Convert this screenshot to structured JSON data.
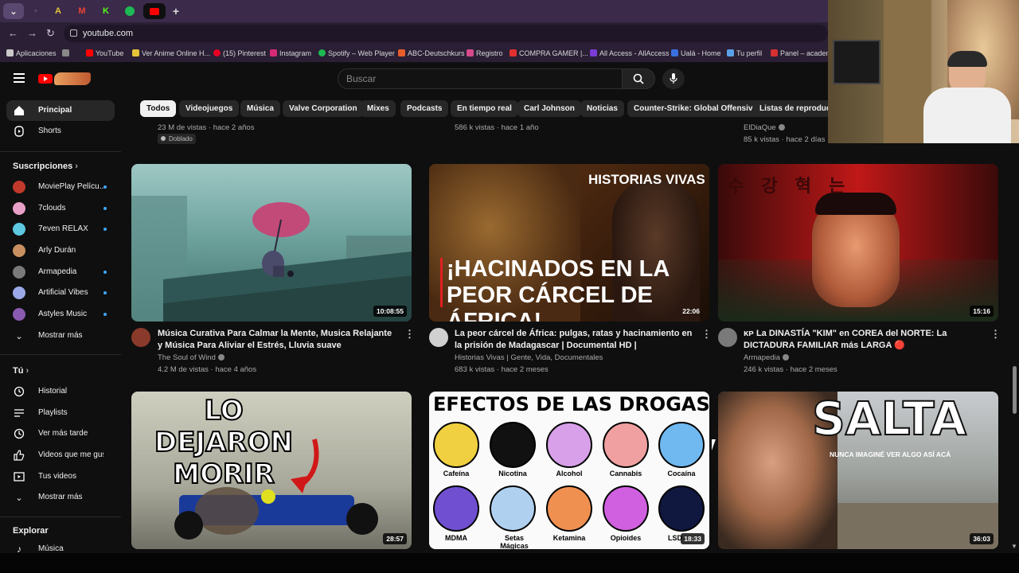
{
  "browser": {
    "url": "youtube.com",
    "bookmarks": [
      {
        "label": "Aplicaciones",
        "color": "#c9c9c9"
      },
      {
        "label": "YouTube",
        "color": "#ff0000"
      },
      {
        "label": "Ver Anime Online H...",
        "color": "#e6c23a"
      },
      {
        "label": "(15) Pinterest",
        "color": "#e60023"
      },
      {
        "label": "Instagram",
        "color": "#d62976"
      },
      {
        "label": "Spotify – Web Player",
        "color": "#1db954"
      },
      {
        "label": "ABC-Deutschkurs",
        "color": "#e85d2a"
      },
      {
        "label": "Registro",
        "color": "#d64a8a"
      },
      {
        "label": "COMPRA GAMER |...",
        "color": "#e03030"
      },
      {
        "label": "All Access - AllAccess",
        "color": "#7a3bd6"
      },
      {
        "label": "Ualá - Home",
        "color": "#3a6fe0"
      },
      {
        "label": "Tu perfil",
        "color": "#5aa0e8"
      },
      {
        "label": "Panel – academia",
        "color": "#d63030"
      }
    ]
  },
  "header": {
    "search_placeholder": "Buscar"
  },
  "chips": [
    "Todos",
    "Videojuegos",
    "Música",
    "Valve Corporation",
    "Mixes",
    "Podcasts",
    "En tiempo real",
    "Carl Johnson",
    "Noticias",
    "Counter-Strike: Global Offensive",
    "Listas de reproducción"
  ],
  "sidebar": {
    "main": [
      {
        "label": "Principal"
      },
      {
        "label": "Shorts"
      }
    ],
    "subs_header": "Suscripciones",
    "subs": [
      {
        "label": "MoviePlay Pelícu...",
        "color": "#c0392b",
        "dot": true
      },
      {
        "label": "7clouds",
        "color": "#e8a0c8",
        "dot": true
      },
      {
        "label": "7even RELAX",
        "color": "#5ec8e0",
        "dot": true
      },
      {
        "label": "Arly Durán",
        "color": "#c89060",
        "dot": false
      },
      {
        "label": "Armapedia",
        "color": "#7a7a7a",
        "dot": true
      },
      {
        "label": "Artificial Vibes",
        "color": "#9aa8e8",
        "dot": true
      },
      {
        "label": "Astyles Music",
        "color": "#8a5ab0",
        "dot": true
      }
    ],
    "show_more": "Mostrar más",
    "you_header": "Tú",
    "you": [
      {
        "label": "Historial"
      },
      {
        "label": "Playlists"
      },
      {
        "label": "Ver más tarde"
      },
      {
        "label": "Videos que me gus..."
      },
      {
        "label": "Tus videos"
      },
      {
        "label": "Mostrar más"
      }
    ],
    "explore_header": "Explorar",
    "explore": [
      {
        "label": "Música"
      }
    ]
  },
  "top_row": [
    {
      "meta": "23 M de vistas · hace 2 años",
      "badge": "Doblado"
    },
    {
      "meta": "586 k vistas · hace 1 año"
    },
    {
      "channel": "ElDiaQue",
      "meta": "85 k vistas · hace 2 días"
    }
  ],
  "videos": [
    {
      "title": "Música Curativa Para Calmar la Mente, Musica Relajante y Música Para Aliviar el Estrés, Lluvia suave",
      "channel": "The Soul of Wind",
      "meta": "4.2 M de vistas · hace 4 años",
      "duration": "10:08:55",
      "avatar": "#8a3a2a"
    },
    {
      "title": "La peor cárcel de África: pulgas, ratas y hacinamiento en la prisión de Madagascar | Documental HD |",
      "channel": "Historias Vivas | Gente, Vida, Documentales",
      "meta": "683 k vistas · hace 2 meses",
      "duration": "22:06",
      "avatar": "#d0d0d0",
      "thumb_top": "HISTORIAS VIVAS",
      "thumb_text": "¡HACINADOS EN LA PEOR CÁRCEL DE ÁFRICA!"
    },
    {
      "title": "ᴋᴘ La DINASTÍA \"KIM\" en COREA del NORTE: La DICTADURA FAMILIAR más LARGA 🔴",
      "channel": "Armapedia",
      "meta": "246 k vistas · hace 2 meses",
      "duration": "15:16",
      "avatar": "#7a7a7a",
      "thumb_text": "수 강   혁 는"
    },
    {
      "duration": "28:57",
      "thumb_text": "LO DEJARON MORIR"
    },
    {
      "duration": "18:33",
      "thumb_title": "EFECTOS DE LAS DROGAS",
      "drugs": [
        "Cafeína",
        "Nicotina",
        "Alcohol",
        "Cannabis",
        "Cocaína",
        "MDMA",
        "Setas Mágicas",
        "Ketamina",
        "Opioides",
        "LSD"
      ]
    },
    {
      "duration": "36:03",
      "thumb_text": "SALTA",
      "thumb_sub": "NUNCA IMAGINÉ VER ALGO ASÍ ACÁ"
    }
  ]
}
